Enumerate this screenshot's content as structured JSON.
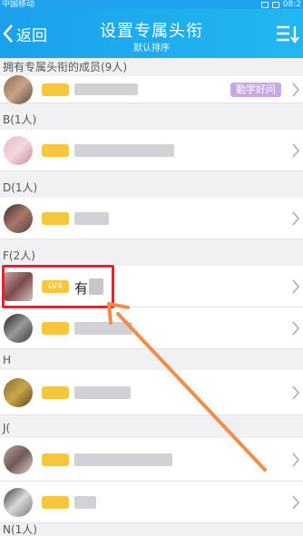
{
  "status_bar": {
    "carrier": "中国移动",
    "time": "08:2"
  },
  "header": {
    "back_label": "返回",
    "title": "设置专属头衔",
    "subtitle": "默认排序"
  },
  "sections": [
    {
      "label": "拥有专属头衔的成员(9人)"
    },
    {
      "label": "B(1人)"
    },
    {
      "label": "D(1人)"
    },
    {
      "label": "F(2人)"
    },
    {
      "label": "H"
    },
    {
      "label": "J("
    },
    {
      "label": "N(1人)"
    }
  ],
  "rows": [
    {
      "badge": "勤学好问"
    },
    {},
    {},
    {
      "level": "LV4",
      "name": "有"
    },
    {},
    {},
    {},
    {}
  ],
  "colors": {
    "header": "#1fa3ee",
    "level_badge": "#f6c63c",
    "title_badge": "#c9a8e6",
    "highlight": "#e0242b",
    "annotation_arrow": "#f28c4b"
  }
}
